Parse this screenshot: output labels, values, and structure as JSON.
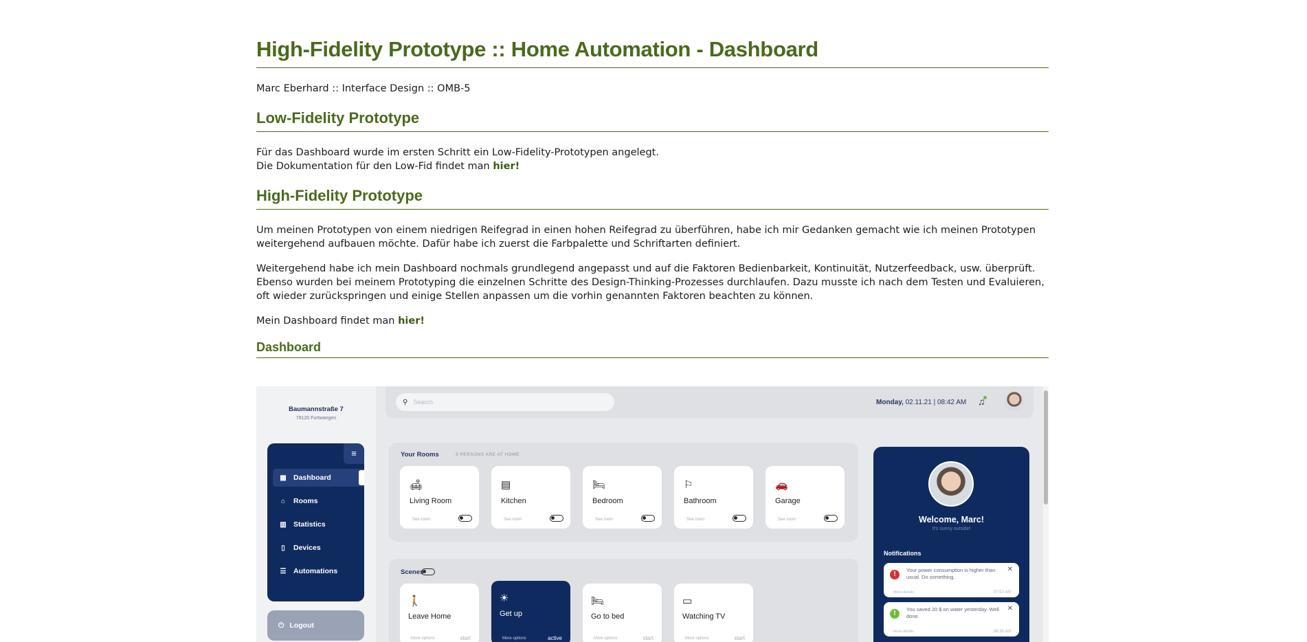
{
  "header": {
    "title": "High-Fidelity Prototype :: Home Automation - Dashboard",
    "byline": "Marc Eberhard :: Interface Design :: OMB-5"
  },
  "lowfi": {
    "heading": "Low-Fidelity Prototype",
    "line1": "Für das Dashboard wurde im ersten Schritt ein Low-Fidelity-Prototypen angelegt.",
    "line2": "Die Dokumentation für den Low-Fid findet man ",
    "link": "hier!"
  },
  "hifi": {
    "heading": "High-Fidelity Prototype",
    "para1": "Um meinen Prototypen von einem niedrigen Reifegrad in einen hohen Reifegrad zu überführen, habe ich mir Gedanken gemacht wie ich meinen Prototypen weitergehend aufbauen möchte. Dafür habe ich zuerst die Farbpalette und Schriftarten definiert.",
    "para2": "Weitergehend habe ich mein Dashboard nochmals grundlegend angepasst und auf die Faktoren Bedienbarkeit, Kontinuität, Nutzerfeedback, usw. überprüft. Ebenso wurden bei meinem Prototyping die einzelnen Schritte des Design-Thinking-Prozesses durchlaufen. Dazu musste ich nach dem Testen und Evaluieren, oft wieder zurückspringen und einige Stellen anpassen um die vorhin genannten Faktoren beachten zu können.",
    "para3": "Mein Dashboard findet man ",
    "link": "hier!"
  },
  "dashboard_section": {
    "heading": "Dashboard"
  },
  "dashboard": {
    "address": "Baumannstraße 7",
    "city": "78120 Furtwangen",
    "search_placeholder": "Search",
    "date_day": "Monday,",
    "date_rest": " 02.11.21 | 08:42 AM",
    "nav": [
      {
        "label": "Dashboard",
        "icon": "grid-icon"
      },
      {
        "label": "Rooms",
        "icon": "home-icon"
      },
      {
        "label": "Statistics",
        "icon": "chart-icon"
      },
      {
        "label": "Devices",
        "icon": "phone-icon"
      },
      {
        "label": "Automations",
        "icon": "sliders-icon"
      }
    ],
    "logout": "Logout",
    "rooms_title": "Your Rooms",
    "rooms_sub": "3 PERSONS ARE AT HOME",
    "rooms": [
      {
        "name": "Living Room",
        "sub": "See room",
        "icon": "sofa-icon"
      },
      {
        "name": "Kitchen",
        "sub": "See room",
        "icon": "fridge-icon"
      },
      {
        "name": "Bedroom",
        "sub": "See room",
        "icon": "bed-icon"
      },
      {
        "name": "Bathroom",
        "sub": "See room",
        "icon": "shower-icon"
      },
      {
        "name": "Garage",
        "sub": "See room",
        "icon": "car-icon"
      }
    ],
    "scenes_title": "Scenes",
    "scenes": [
      {
        "name": "Leave Home",
        "more": "More options",
        "status": "start",
        "icon": "walk-icon"
      },
      {
        "name": "Get up",
        "more": "More options",
        "status": "active",
        "icon": "sun-icon"
      },
      {
        "name": "Go to bed",
        "more": "More options",
        "status": "start",
        "icon": "bed-icon"
      },
      {
        "name": "Watching TV",
        "more": "More options",
        "status": "start",
        "icon": "tv-icon"
      }
    ],
    "welcome": "Welcome, Marc!",
    "weather": "It's sunny outside!",
    "notifications_title": "Notifications",
    "notifications": [
      {
        "text": "Your power consumption is higher than usual. Do something.",
        "more": "More details",
        "time": "07:52 AM",
        "color": "#d93030"
      },
      {
        "text": "You saved 20 $ on water yesterday. Well done.",
        "more": "More details",
        "time": "08:38 AM",
        "color": "#6cbe3a"
      }
    ]
  }
}
